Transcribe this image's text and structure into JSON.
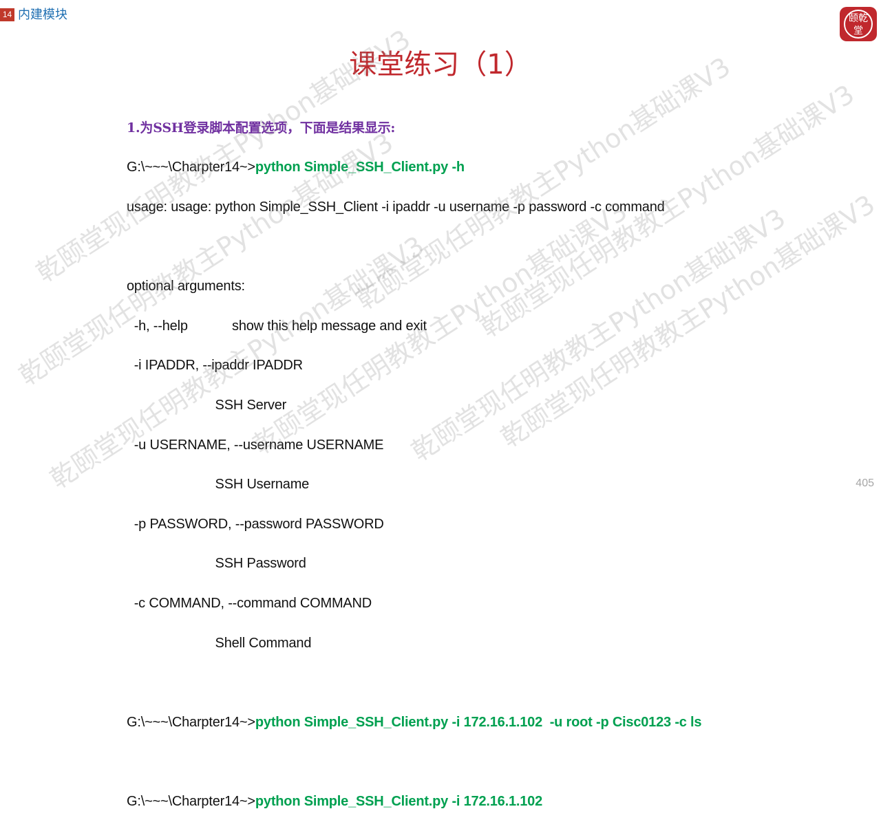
{
  "header": {
    "chapter_number": "14",
    "chapter_title": "内建模块"
  },
  "logo": {
    "text": "乾颐堂"
  },
  "title": "课堂练习（1）",
  "content": {
    "question": "1.为SSH登录脚本配置选项，下面是结果显示:",
    "prompt": "G:\\~~~\\Charpter14~>",
    "cmd_help": "python Simple_SSH_Client.py -h",
    "usage": "usage: usage: python Simple_SSH_Client -i ipaddr -u username -p password -c command",
    "optional_header": "optional arguments:",
    "opt_help": "  -h, --help            show this help message and exit",
    "opt_ip": "  -i IPADDR, --ipaddr IPADDR",
    "opt_ip_desc": "                        SSH Server",
    "opt_user": "  -u USERNAME, --username USERNAME",
    "opt_user_desc": "                        SSH Username",
    "opt_pass": "  -p PASSWORD, --password PASSWORD",
    "opt_pass_desc": "                        SSH Password",
    "opt_cmd": "  -c COMMAND, --command COMMAND",
    "opt_cmd_desc": "                        Shell Command",
    "cmd_full": "python Simple_SSH_Client.py -i 172.16.1.102  -u root -p Cisc0123 -c ls",
    "cmd_short": "python Simple_SSH_Client.py -i 172.16.1.102"
  },
  "watermark_text": "乾颐堂现任明教教主Python基础课V3",
  "page_number": "405"
}
